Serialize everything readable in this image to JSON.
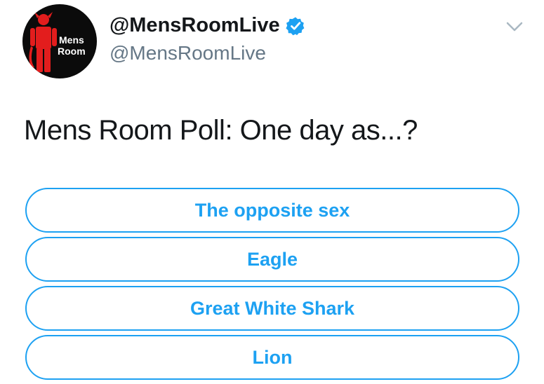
{
  "tweet": {
    "avatar": {
      "line1": "Mens",
      "line2": "Room"
    },
    "display_name": "@MensRoomLive",
    "verified_icon": "verified-badge-icon",
    "handle": "@MensRoomLive",
    "menu_icon": "chevron-down-icon",
    "text": "Mens Room Poll: One day as...?",
    "poll": {
      "options": [
        {
          "label": "The opposite sex"
        },
        {
          "label": "Eagle"
        },
        {
          "label": "Great White Shark"
        },
        {
          "label": "Lion"
        }
      ]
    }
  },
  "colors": {
    "accent": "#1da1f2",
    "text": "#14171a",
    "secondary_text": "#657786",
    "avatar_bg": "#0b0b0b",
    "logo_red": "#e31d1d"
  }
}
